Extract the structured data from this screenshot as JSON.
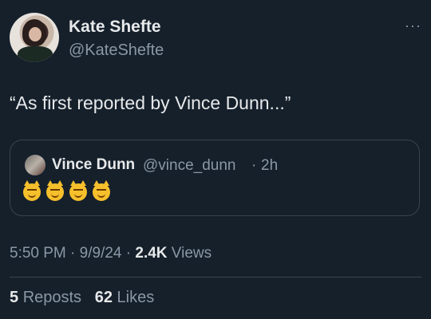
{
  "author": {
    "name": "Kate Shefte",
    "handle": "@KateShefte",
    "more_icon": "···"
  },
  "tweet": {
    "text": "“As first reported by Vince Dunn...”"
  },
  "quote": {
    "name": "Vince Dunn",
    "handle": "@vince_dunn",
    "separator": "·",
    "time": "2h",
    "emojis": [
      "smirking-cat-emoji",
      "smirking-cat-emoji",
      "smirking-cat-emoji",
      "smirking-cat-emoji"
    ]
  },
  "meta": {
    "time": "5:50 PM",
    "sep1": "·",
    "date": "9/9/24",
    "sep2": "·",
    "views_count": "2.4K",
    "views_label": "Views"
  },
  "stats": {
    "reposts_count": "5",
    "reposts_label": "Reposts",
    "likes_count": "62",
    "likes_label": "Likes"
  },
  "colors": {
    "background": "#15202b",
    "text": "#e7e9ea",
    "secondary": "#8b98a5",
    "border": "#38444d"
  }
}
